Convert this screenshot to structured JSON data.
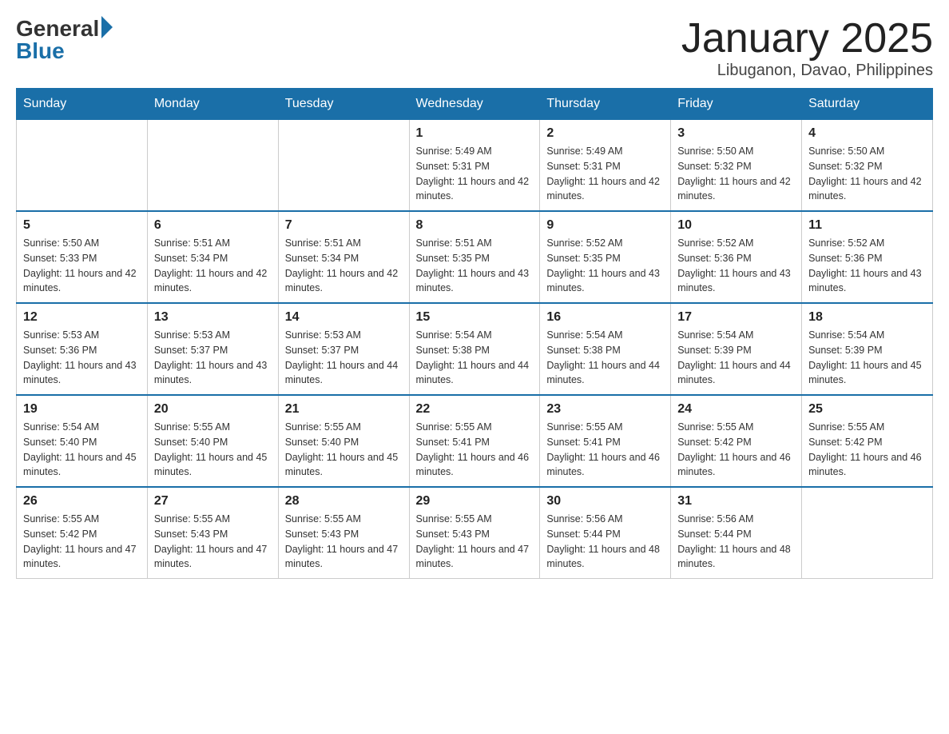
{
  "logo": {
    "general": "General",
    "blue": "Blue"
  },
  "header": {
    "title": "January 2025",
    "location": "Libuganon, Davao, Philippines"
  },
  "days": [
    "Sunday",
    "Monday",
    "Tuesday",
    "Wednesday",
    "Thursday",
    "Friday",
    "Saturday"
  ],
  "weeks": [
    [
      {
        "day": "",
        "info": ""
      },
      {
        "day": "",
        "info": ""
      },
      {
        "day": "",
        "info": ""
      },
      {
        "day": "1",
        "info": "Sunrise: 5:49 AM\nSunset: 5:31 PM\nDaylight: 11 hours and 42 minutes."
      },
      {
        "day": "2",
        "info": "Sunrise: 5:49 AM\nSunset: 5:31 PM\nDaylight: 11 hours and 42 minutes."
      },
      {
        "day": "3",
        "info": "Sunrise: 5:50 AM\nSunset: 5:32 PM\nDaylight: 11 hours and 42 minutes."
      },
      {
        "day": "4",
        "info": "Sunrise: 5:50 AM\nSunset: 5:32 PM\nDaylight: 11 hours and 42 minutes."
      }
    ],
    [
      {
        "day": "5",
        "info": "Sunrise: 5:50 AM\nSunset: 5:33 PM\nDaylight: 11 hours and 42 minutes."
      },
      {
        "day": "6",
        "info": "Sunrise: 5:51 AM\nSunset: 5:34 PM\nDaylight: 11 hours and 42 minutes."
      },
      {
        "day": "7",
        "info": "Sunrise: 5:51 AM\nSunset: 5:34 PM\nDaylight: 11 hours and 42 minutes."
      },
      {
        "day": "8",
        "info": "Sunrise: 5:51 AM\nSunset: 5:35 PM\nDaylight: 11 hours and 43 minutes."
      },
      {
        "day": "9",
        "info": "Sunrise: 5:52 AM\nSunset: 5:35 PM\nDaylight: 11 hours and 43 minutes."
      },
      {
        "day": "10",
        "info": "Sunrise: 5:52 AM\nSunset: 5:36 PM\nDaylight: 11 hours and 43 minutes."
      },
      {
        "day": "11",
        "info": "Sunrise: 5:52 AM\nSunset: 5:36 PM\nDaylight: 11 hours and 43 minutes."
      }
    ],
    [
      {
        "day": "12",
        "info": "Sunrise: 5:53 AM\nSunset: 5:36 PM\nDaylight: 11 hours and 43 minutes."
      },
      {
        "day": "13",
        "info": "Sunrise: 5:53 AM\nSunset: 5:37 PM\nDaylight: 11 hours and 43 minutes."
      },
      {
        "day": "14",
        "info": "Sunrise: 5:53 AM\nSunset: 5:37 PM\nDaylight: 11 hours and 44 minutes."
      },
      {
        "day": "15",
        "info": "Sunrise: 5:54 AM\nSunset: 5:38 PM\nDaylight: 11 hours and 44 minutes."
      },
      {
        "day": "16",
        "info": "Sunrise: 5:54 AM\nSunset: 5:38 PM\nDaylight: 11 hours and 44 minutes."
      },
      {
        "day": "17",
        "info": "Sunrise: 5:54 AM\nSunset: 5:39 PM\nDaylight: 11 hours and 44 minutes."
      },
      {
        "day": "18",
        "info": "Sunrise: 5:54 AM\nSunset: 5:39 PM\nDaylight: 11 hours and 45 minutes."
      }
    ],
    [
      {
        "day": "19",
        "info": "Sunrise: 5:54 AM\nSunset: 5:40 PM\nDaylight: 11 hours and 45 minutes."
      },
      {
        "day": "20",
        "info": "Sunrise: 5:55 AM\nSunset: 5:40 PM\nDaylight: 11 hours and 45 minutes."
      },
      {
        "day": "21",
        "info": "Sunrise: 5:55 AM\nSunset: 5:40 PM\nDaylight: 11 hours and 45 minutes."
      },
      {
        "day": "22",
        "info": "Sunrise: 5:55 AM\nSunset: 5:41 PM\nDaylight: 11 hours and 46 minutes."
      },
      {
        "day": "23",
        "info": "Sunrise: 5:55 AM\nSunset: 5:41 PM\nDaylight: 11 hours and 46 minutes."
      },
      {
        "day": "24",
        "info": "Sunrise: 5:55 AM\nSunset: 5:42 PM\nDaylight: 11 hours and 46 minutes."
      },
      {
        "day": "25",
        "info": "Sunrise: 5:55 AM\nSunset: 5:42 PM\nDaylight: 11 hours and 46 minutes."
      }
    ],
    [
      {
        "day": "26",
        "info": "Sunrise: 5:55 AM\nSunset: 5:42 PM\nDaylight: 11 hours and 47 minutes."
      },
      {
        "day": "27",
        "info": "Sunrise: 5:55 AM\nSunset: 5:43 PM\nDaylight: 11 hours and 47 minutes."
      },
      {
        "day": "28",
        "info": "Sunrise: 5:55 AM\nSunset: 5:43 PM\nDaylight: 11 hours and 47 minutes."
      },
      {
        "day": "29",
        "info": "Sunrise: 5:55 AM\nSunset: 5:43 PM\nDaylight: 11 hours and 47 minutes."
      },
      {
        "day": "30",
        "info": "Sunrise: 5:56 AM\nSunset: 5:44 PM\nDaylight: 11 hours and 48 minutes."
      },
      {
        "day": "31",
        "info": "Sunrise: 5:56 AM\nSunset: 5:44 PM\nDaylight: 11 hours and 48 minutes."
      },
      {
        "day": "",
        "info": ""
      }
    ]
  ]
}
